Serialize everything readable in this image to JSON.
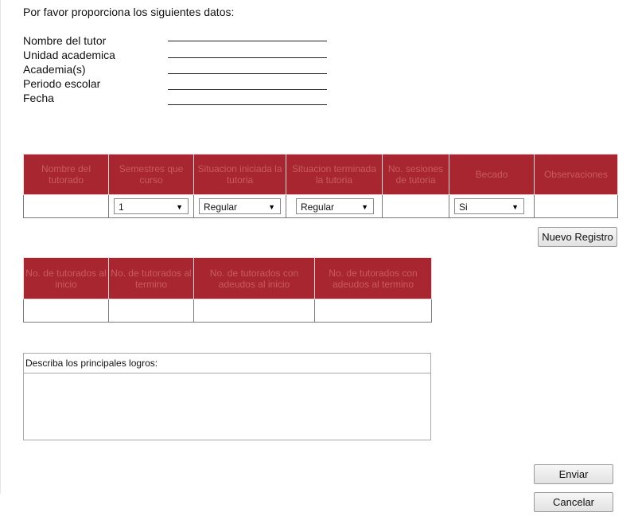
{
  "intro": "Por favor proporciona los siguientes datos:",
  "form_fields": [
    "Nombre del tutor",
    "Unidad academica",
    "Academia(s)",
    "Periodo escolar",
    "Fecha"
  ],
  "table1": {
    "headers": [
      "Nombre del tutorado",
      "Semestres que curso",
      "Situacion iniciada la tutoria",
      "Situacion terminada la tutoria",
      "No. sesiones de tutoria",
      "Becado",
      "Observaciones"
    ],
    "row": {
      "semestres": "1",
      "situacion_iniciada": "Regular",
      "situacion_terminada": "Regular",
      "becado": "Si"
    }
  },
  "buttons": {
    "nuevo_registro": "Nuevo Registro",
    "enviar": "Enviar",
    "cancelar": "Cancelar"
  },
  "table2": {
    "headers": [
      "No. de tutorados al inicio",
      "No. de tutorados al termino",
      "No. de tutorados con adeudos al inicio",
      "No. de tutorados con adeudos al termino"
    ]
  },
  "logros": {
    "label": "Describa los principales logros:",
    "value": ""
  },
  "colors": {
    "header_bg": "#a8262f",
    "header_text": "#c85a60"
  },
  "icons": {
    "select_arrow": "dropdown-arrow-icon"
  }
}
